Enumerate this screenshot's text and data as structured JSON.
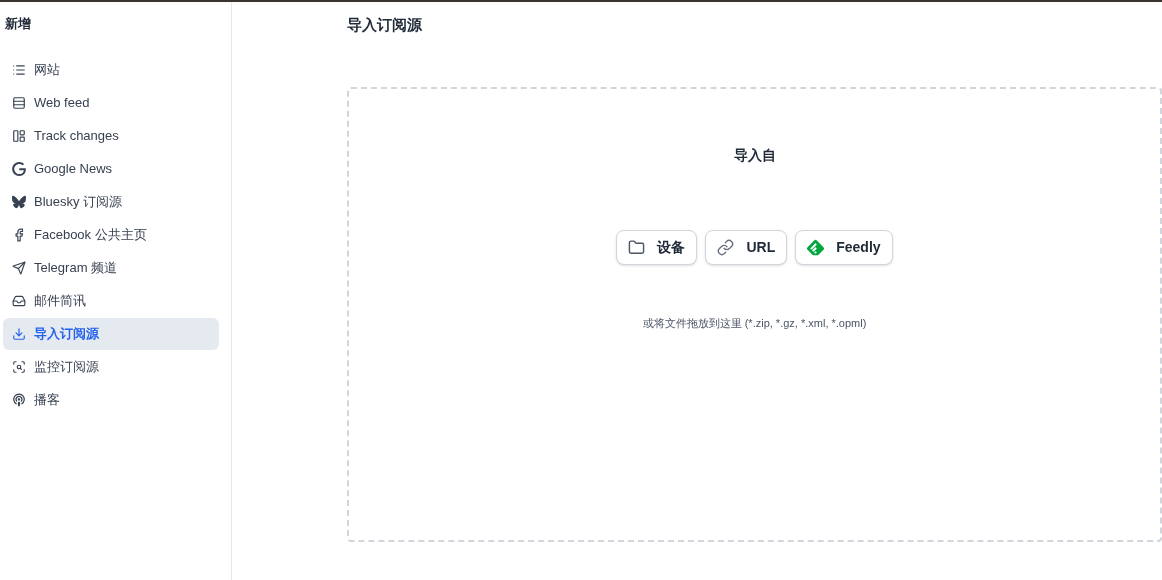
{
  "sidebar": {
    "title": "新增",
    "items": [
      {
        "label": "网站",
        "selected": false
      },
      {
        "label": "Web feed",
        "selected": false
      },
      {
        "label": "Track changes",
        "selected": false
      },
      {
        "label": "Google News",
        "selected": false
      },
      {
        "label": "Bluesky 订阅源",
        "selected": false
      },
      {
        "label": "Facebook 公共主页",
        "selected": false
      },
      {
        "label": "Telegram 频道",
        "selected": false
      },
      {
        "label": "邮件简讯",
        "selected": false
      },
      {
        "label": "导入订阅源",
        "selected": true
      },
      {
        "label": "监控订阅源",
        "selected": false
      },
      {
        "label": "播客",
        "selected": false
      }
    ]
  },
  "main": {
    "title": "导入订阅源",
    "dropzone": {
      "heading": "导入自",
      "buttons": [
        {
          "label": "设备"
        },
        {
          "label": "URL"
        },
        {
          "label": "Feedly"
        }
      ],
      "hint": "或将文件拖放到这里 (*.zip, *.gz, *.xml, *.opml)"
    }
  }
}
